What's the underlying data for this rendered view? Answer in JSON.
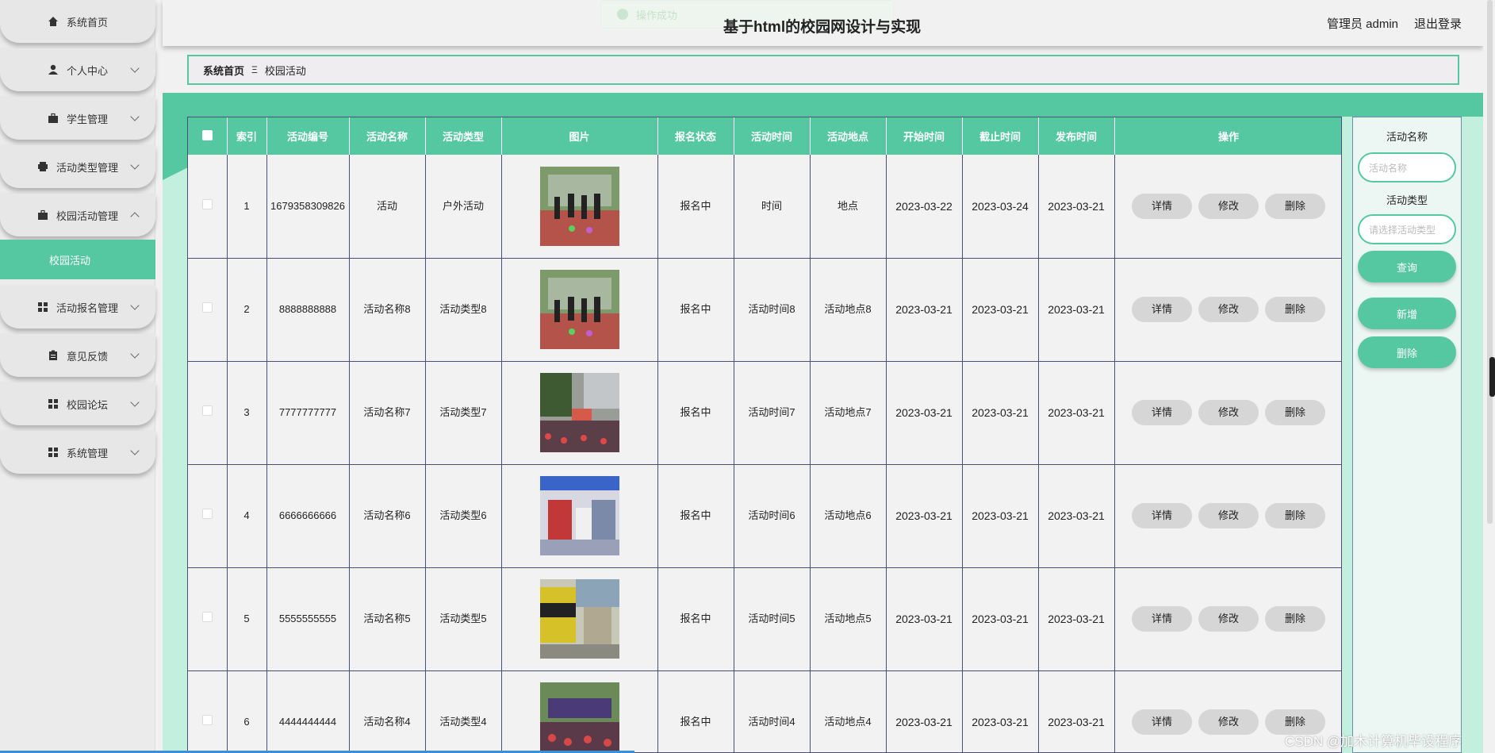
{
  "sidebar": {
    "items": [
      {
        "label": "系统首页",
        "icon": "home-icon",
        "expandable": false
      },
      {
        "label": "个人中心",
        "icon": "person-icon",
        "expandable": true
      },
      {
        "label": "学生管理",
        "icon": "briefcase-icon",
        "expandable": true
      },
      {
        "label": "活动类型管理",
        "icon": "printer-icon",
        "expandable": true
      },
      {
        "label": "校园活动管理",
        "icon": "briefcase-icon",
        "expandable": true,
        "expanded": true
      },
      {
        "label": "活动报名管理",
        "icon": "grid-icon",
        "expandable": true
      },
      {
        "label": "意见反馈",
        "icon": "clipboard-icon",
        "expandable": true
      },
      {
        "label": "校园论坛",
        "icon": "grid-icon",
        "expandable": true
      },
      {
        "label": "系统管理",
        "icon": "grid-icon",
        "expandable": true
      }
    ],
    "active_submenu": "校园活动"
  },
  "header": {
    "toast": "操作成功",
    "title": "基于html的校园网设计与实现",
    "user": "管理员 admin",
    "logout": "退出登录"
  },
  "breadcrumb": {
    "home": "系统首页",
    "separator": "Ξ",
    "current": "校园活动"
  },
  "table": {
    "headers": [
      "索引",
      "活动编号",
      "活动名称",
      "活动类型",
      "图片",
      "报名状态",
      "活动时间",
      "活动地点",
      "开始时间",
      "截止时间",
      "发布时间",
      "操作"
    ],
    "rows": [
      {
        "index": "1",
        "code": "1679358309826",
        "name": "活动",
        "type": "户外活动",
        "status": "报名中",
        "time": "时间",
        "place": "地点",
        "start": "2023-03-22",
        "end": "2023-03-24",
        "publish": "2023-03-21",
        "image": "sports-game-photo"
      },
      {
        "index": "2",
        "code": "8888888888",
        "name": "活动名称8",
        "type": "活动类型8",
        "status": "报名中",
        "time": "活动时间8",
        "place": "活动地点8",
        "start": "2023-03-21",
        "end": "2023-03-21",
        "publish": "2023-03-21",
        "image": "sports-game-photo"
      },
      {
        "index": "3",
        "code": "7777777777",
        "name": "活动名称7",
        "type": "活动类型7",
        "status": "报名中",
        "time": "活动时间7",
        "place": "活动地点7",
        "start": "2023-03-21",
        "end": "2023-03-21",
        "publish": "2023-03-21",
        "image": "campus-crowd-photo"
      },
      {
        "index": "4",
        "code": "6666666666",
        "name": "活动名称6",
        "type": "活动类型6",
        "status": "报名中",
        "time": "活动时间6",
        "place": "活动地点6",
        "start": "2023-03-21",
        "end": "2023-03-21",
        "publish": "2023-03-21",
        "image": "booth-photo"
      },
      {
        "index": "5",
        "code": "5555555555",
        "name": "活动名称5",
        "type": "活动类型5",
        "status": "报名中",
        "time": "活动时间5",
        "place": "活动地点5",
        "start": "2023-03-21",
        "end": "2023-03-21",
        "publish": "2023-03-21",
        "image": "street-banner-photo"
      },
      {
        "index": "6",
        "code": "4444444444",
        "name": "活动名称4",
        "type": "活动类型4",
        "status": "报名中",
        "time": "活动时间4",
        "place": "活动地点4",
        "start": "2023-03-21",
        "end": "2023-03-21",
        "publish": "2023-03-21",
        "image": "market-crowd-photo"
      }
    ],
    "actions": {
      "detail": "详情",
      "edit": "修改",
      "delete": "删除"
    }
  },
  "search": {
    "name_label": "活动名称",
    "name_placeholder": "活动名称",
    "type_label": "活动类型",
    "type_placeholder": "请选择活动类型",
    "query_button": "查询",
    "add_button": "新增",
    "delete_button": "删除"
  },
  "watermark": "CSDN @加木计算机毕设程序",
  "colors": {
    "accent": "#55c8a1",
    "accent_light": "#c3efde",
    "table_border": "#4a4f7a"
  }
}
